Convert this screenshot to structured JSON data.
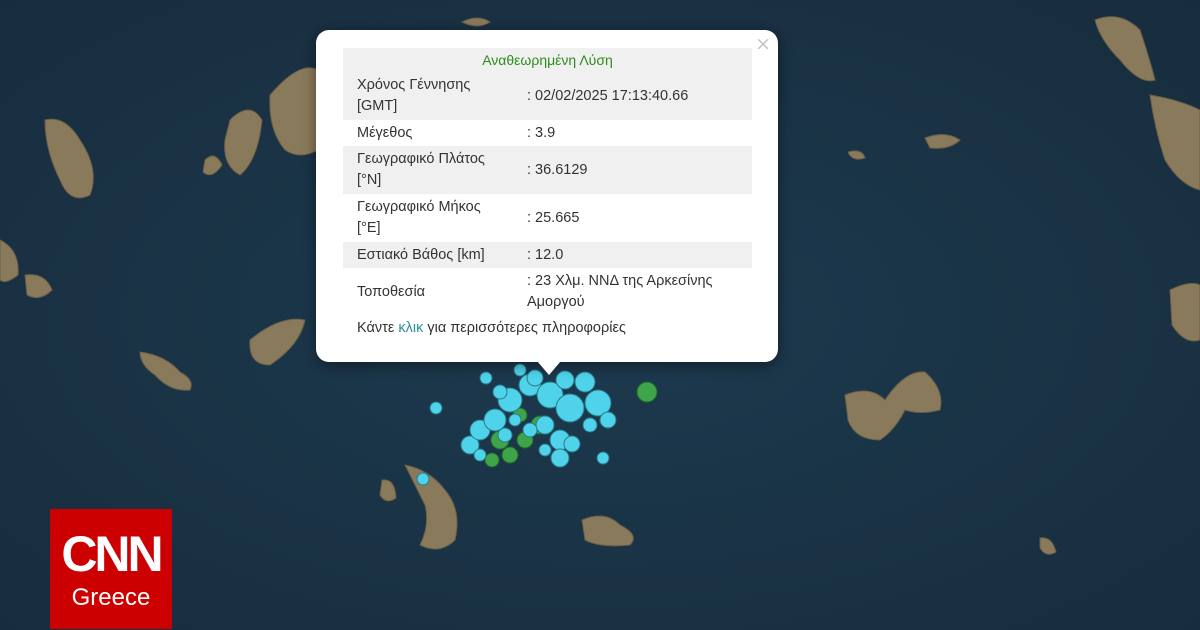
{
  "popup": {
    "title": "Αναθεωρημένη Λύση",
    "close_label": "×",
    "rows": [
      {
        "label": "Χρόνος Γέννησης [GMT]",
        "value": ": 02/02/2025 17:13:40.66"
      },
      {
        "label": "Μέγεθος",
        "value": ": 3.9"
      },
      {
        "label": "Γεωγραφικό Πλάτος [°N]",
        "value": ": 36.6129"
      },
      {
        "label": "Γεωγραφικό Μήκος [°E]",
        "value": ": 25.665"
      },
      {
        "label": "Εστιακό Βάθος [km]",
        "value": ": 12.0"
      },
      {
        "label": "Τοποθεσία",
        "value": ": 23 Χλμ. ΝΝΔ της Αρκεσίνης Αμοργού"
      }
    ],
    "footer_prefix": "Κάντε ",
    "footer_link": "κλικ",
    "footer_suffix": " για περισσότερες πληροφορίες"
  },
  "logo": {
    "brand": "CNN",
    "region": "Greece"
  },
  "map": {
    "sea_color": "#1b3447",
    "land_color": "#8a7a5c",
    "marker_colors": {
      "recent": "#4fd3ea",
      "older": "#3fa34a"
    }
  }
}
